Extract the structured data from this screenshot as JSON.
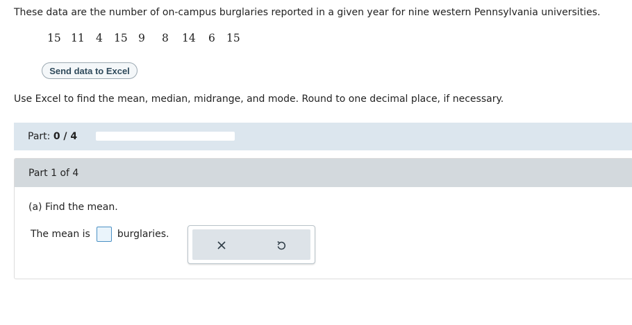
{
  "intro": "These data are the number of on-campus burglaries reported in a given year for nine western Pennsylvania universities.",
  "data_values": [
    "15",
    "11",
    "4",
    "15",
    "9",
    "8",
    "14",
    "6",
    "15"
  ],
  "excel_button": "Send data to Excel",
  "instructions": "Use Excel to find the mean, median, midrange, and mode. Round to one decimal place, if necessary.",
  "part_progress": {
    "label": "Part:",
    "value": "0 / 4",
    "fraction": 0
  },
  "part_header": "Part 1 of 4",
  "question": "(a) Find the mean.",
  "answer": {
    "prefix": "The mean is",
    "suffix": "burglaries.",
    "value": ""
  },
  "tools": {
    "clear_icon": "x-icon",
    "undo_icon": "undo-icon"
  },
  "colors": {
    "accent": "#4a90c4",
    "part_bar": "#dce6ee",
    "card_header": "#d3d9dd",
    "tool_panel": "#dde3e8"
  }
}
